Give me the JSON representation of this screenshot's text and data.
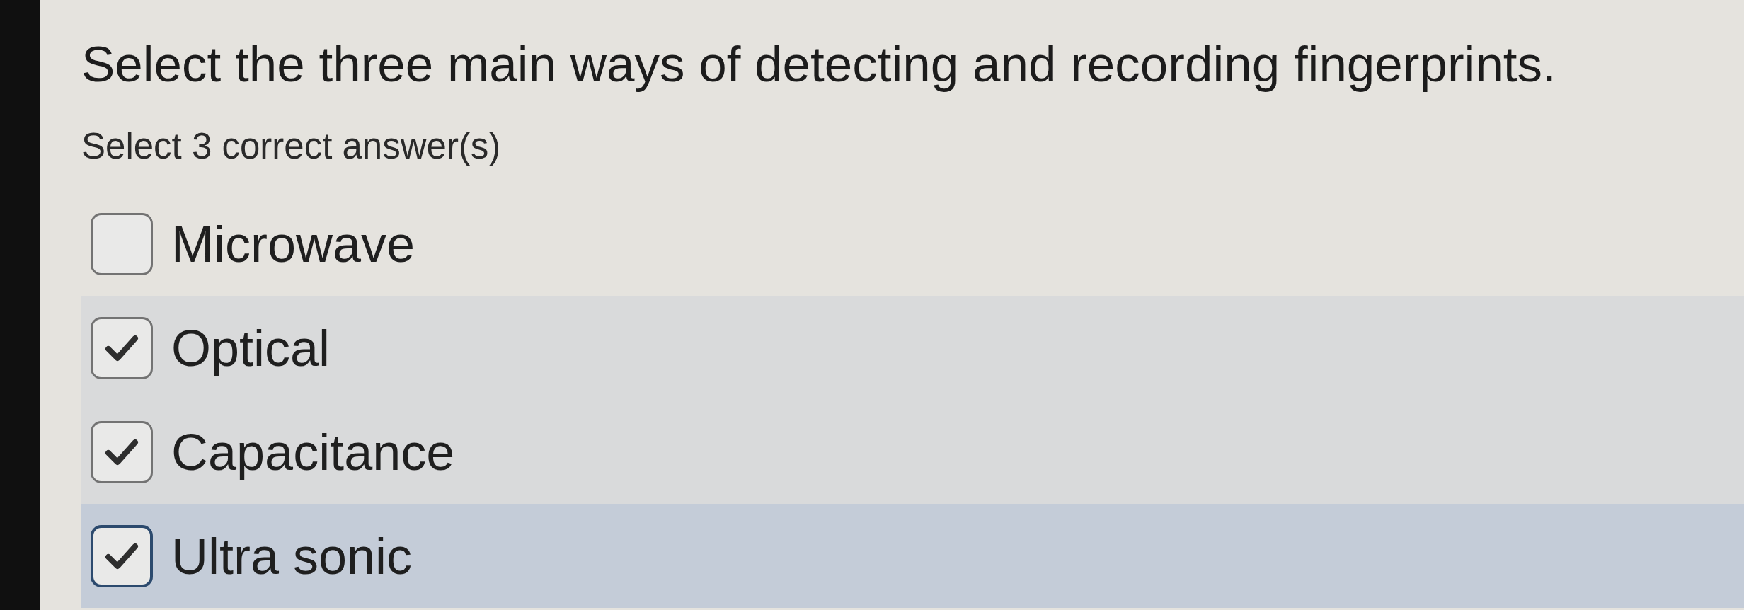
{
  "question": {
    "title": "Select the three main ways of detecting and recording fingerprints.",
    "instruction": "Select 3 correct answer(s)"
  },
  "options": [
    {
      "label": "Microwave",
      "checked": false,
      "focused": false
    },
    {
      "label": "Optical",
      "checked": true,
      "focused": false
    },
    {
      "label": "Capacitance",
      "checked": true,
      "focused": false
    },
    {
      "label": "Ultra sonic",
      "checked": true,
      "focused": true
    }
  ]
}
